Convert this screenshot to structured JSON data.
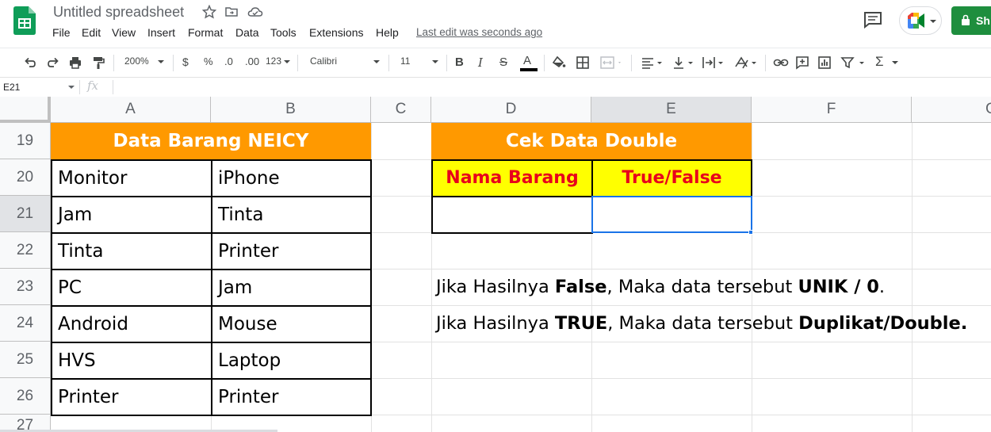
{
  "doc": {
    "title": "Untitled spreadsheet"
  },
  "menu": {
    "items": [
      "File",
      "Edit",
      "View",
      "Insert",
      "Format",
      "Data",
      "Tools",
      "Extensions",
      "Help"
    ],
    "last_edit": "Last edit was seconds ago"
  },
  "share": {
    "label": "Sh"
  },
  "toolbar": {
    "zoom": "200%",
    "currency": "$",
    "percent": "%",
    "decrease_decimal": ".0",
    "increase_decimal": ".00",
    "more_formats": "123",
    "font": "Calibri",
    "font_size": "11",
    "bold": "B",
    "italic": "I",
    "strike": "S",
    "text_color": "A",
    "functions": "Σ"
  },
  "formula_bar": {
    "name_box": "E21",
    "fx": "fx"
  },
  "columns": [
    "A",
    "B",
    "C",
    "D",
    "E",
    "F",
    "G"
  ],
  "rows": [
    "19",
    "20",
    "21",
    "22",
    "23",
    "24",
    "25",
    "26",
    "27"
  ],
  "table_left": {
    "header": "Data Barang NEICY",
    "col_a": [
      "Monitor",
      "Jam",
      "Tinta",
      "PC",
      "Android",
      "HVS",
      "Printer"
    ],
    "col_b": [
      "iPhone",
      "Tinta",
      "Printer",
      "Jam",
      "Mouse",
      "Laptop",
      "Printer"
    ]
  },
  "table_right": {
    "header": "Cek Data Double",
    "col_d_header": "Nama Barang",
    "col_e_header": "True/False"
  },
  "notes": {
    "line1": {
      "prefix": "Jika Hasilnya ",
      "bold1": "False",
      "middle": ", Maka data tersebut ",
      "bold2": "UNIK / 0",
      "suffix": "."
    },
    "line2": {
      "prefix": "Jika Hasilnya ",
      "bold1": "TRUE",
      "middle": ", Maka data tersebut ",
      "bold2": "Duplikat/Double."
    }
  },
  "colors": {
    "orange_header": "#ff9900",
    "yellow_header": "#ffff00",
    "red_text": "#e8001c",
    "selection": "#1a73e8",
    "share_green": "#1e8e3e"
  }
}
